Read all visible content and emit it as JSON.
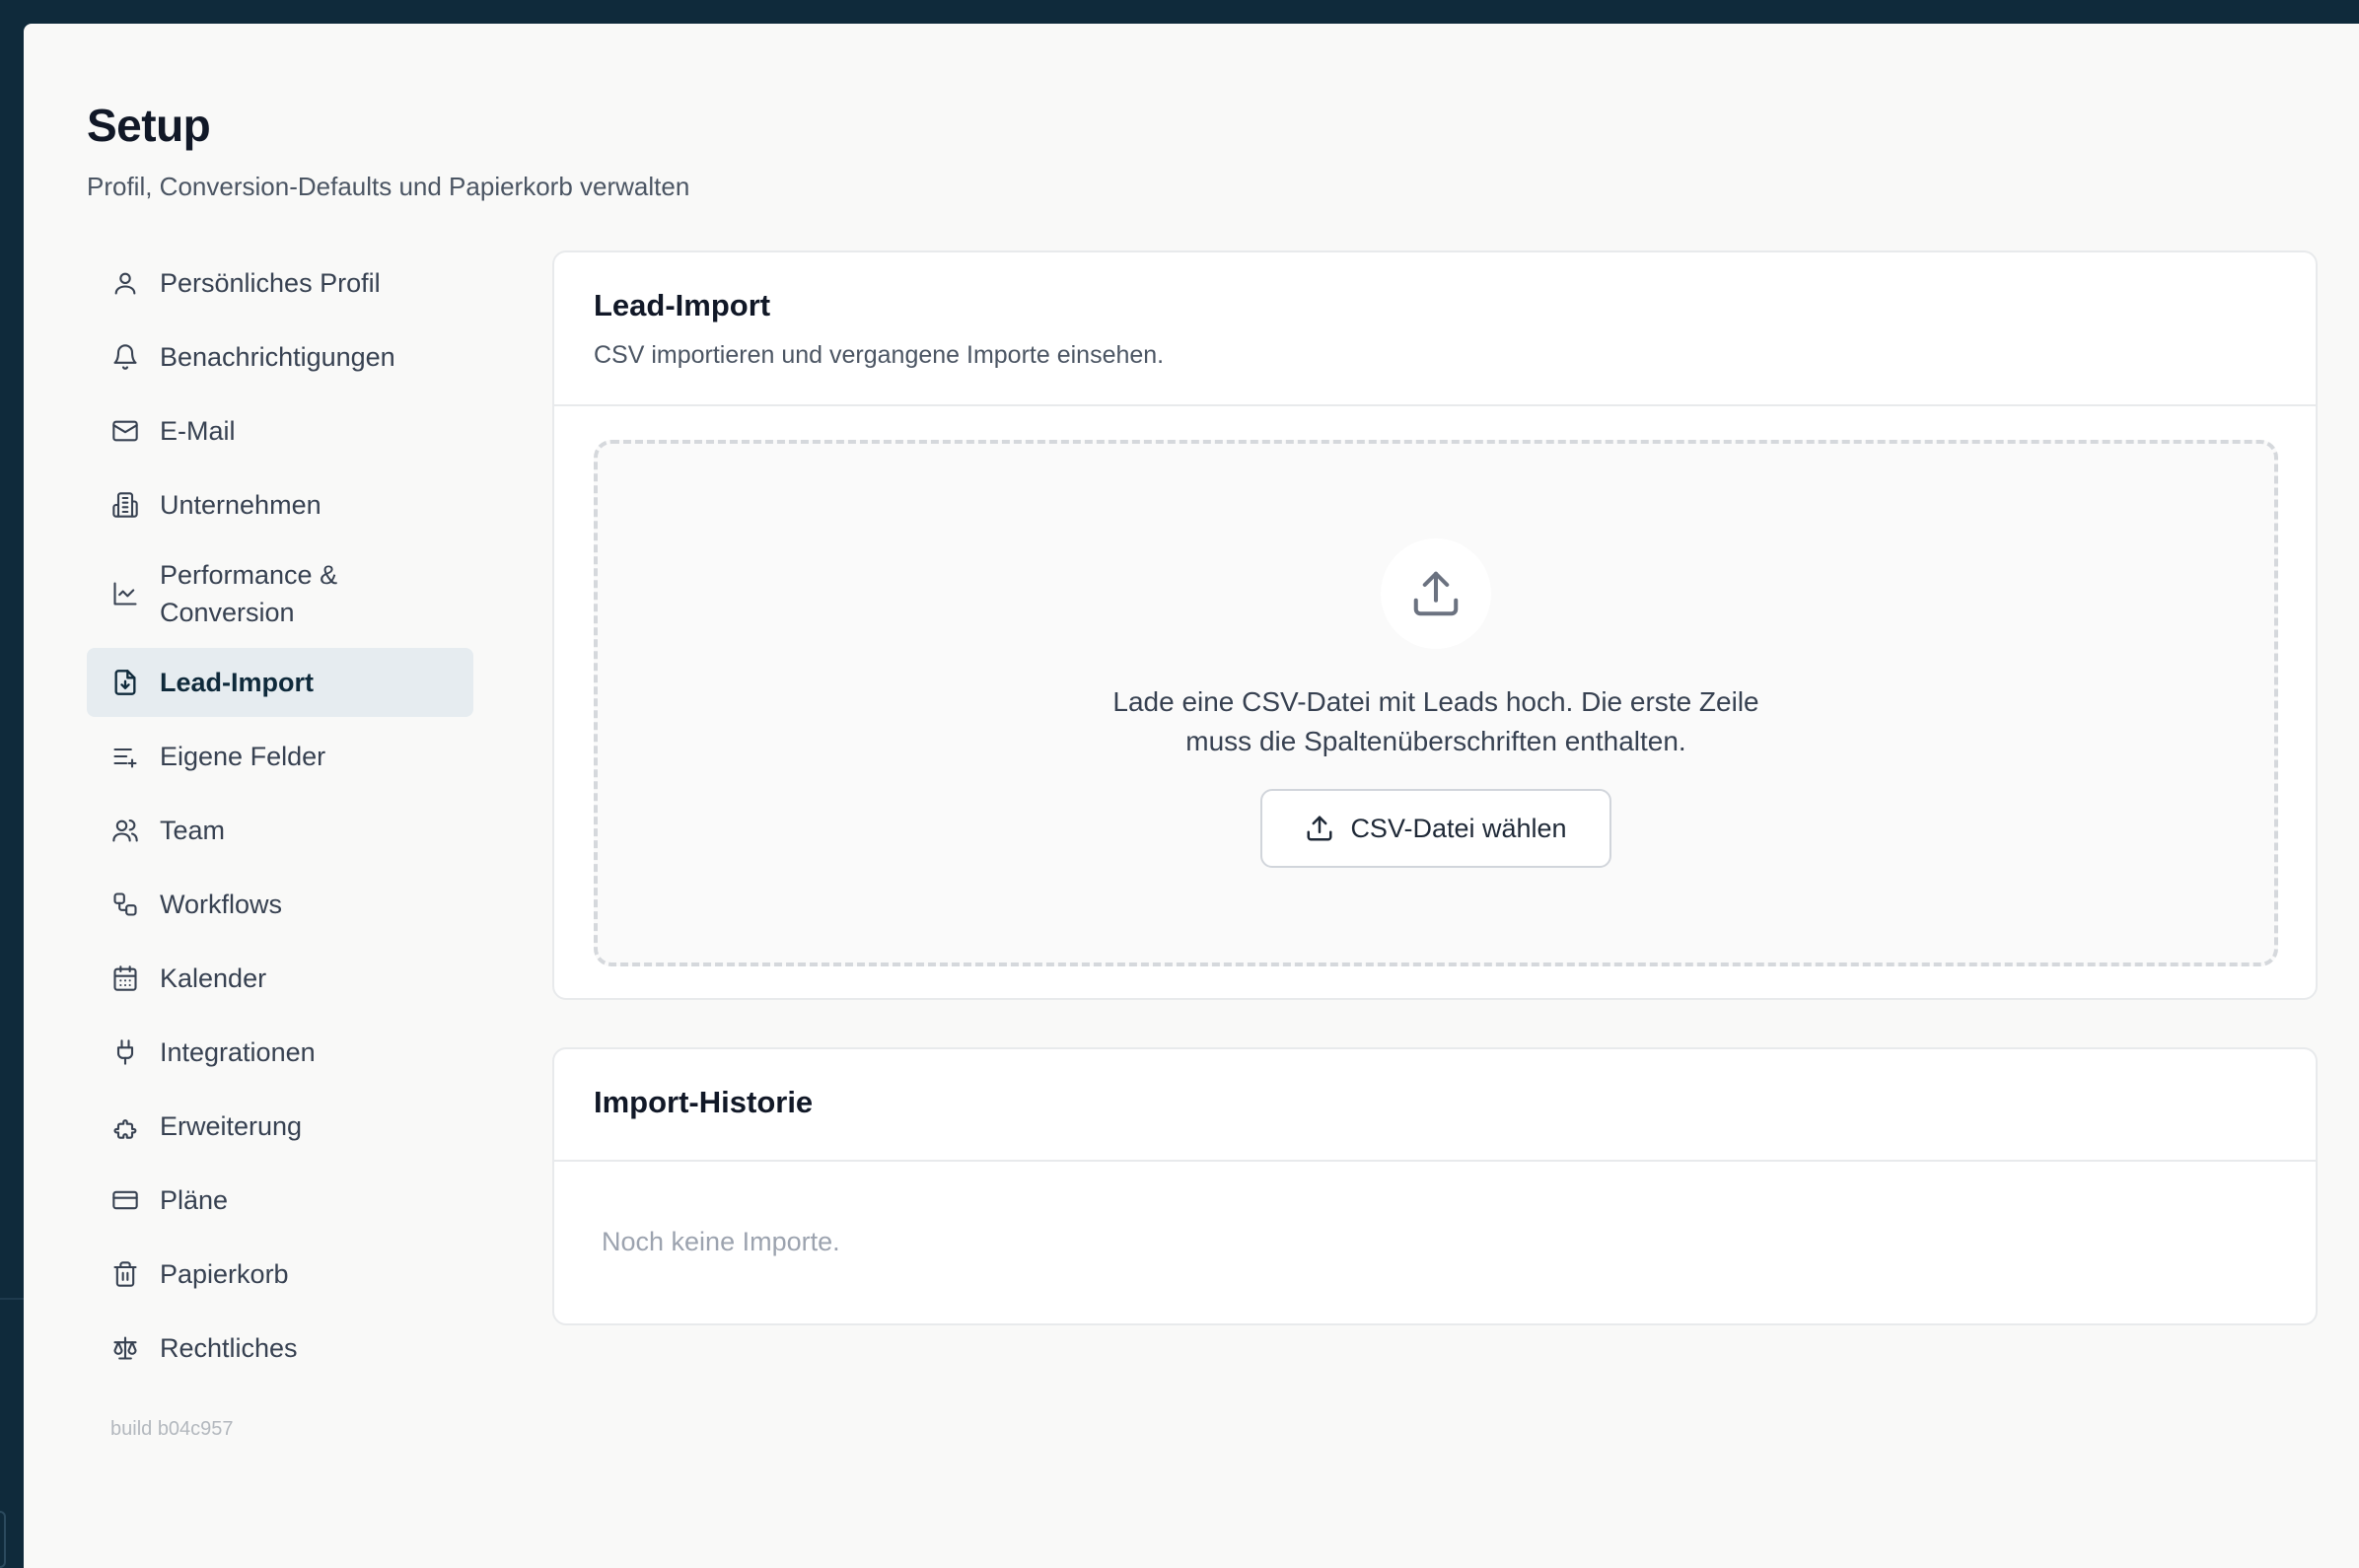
{
  "page": {
    "title": "Setup",
    "subtitle": "Profil, Conversion-Defaults und Papierkorb verwalten"
  },
  "sidebar": {
    "items": [
      {
        "label": "Persönliches Profil",
        "icon": "user-icon"
      },
      {
        "label": "Benachrichtigungen",
        "icon": "bell-icon"
      },
      {
        "label": "E-Mail",
        "icon": "mail-icon"
      },
      {
        "label": "Unternehmen",
        "icon": "building-icon"
      },
      {
        "label": "Performance & Conversion",
        "icon": "line-chart-icon"
      },
      {
        "label": "Lead-Import",
        "icon": "file-import-icon",
        "active": true
      },
      {
        "label": "Eigene Felder",
        "icon": "list-plus-icon"
      },
      {
        "label": "Team",
        "icon": "users-icon"
      },
      {
        "label": "Workflows",
        "icon": "workflow-icon"
      },
      {
        "label": "Kalender",
        "icon": "calendar-icon"
      },
      {
        "label": "Integrationen",
        "icon": "plug-icon"
      },
      {
        "label": "Erweiterung",
        "icon": "puzzle-icon"
      },
      {
        "label": "Pläne",
        "icon": "credit-card-icon"
      },
      {
        "label": "Papierkorb",
        "icon": "trash-icon"
      },
      {
        "label": "Rechtliches",
        "icon": "scale-icon"
      }
    ],
    "build": "build b04c957"
  },
  "import_card": {
    "title": "Lead-Import",
    "description": "CSV importieren und vergangene Importe einsehen.",
    "dropzone_text_line1": "Lade eine CSV-Datei mit Leads hoch. Die erste Zeile",
    "dropzone_text_line2": "muss die Spaltenüberschriften enthalten.",
    "button_label": "CSV-Datei wählen"
  },
  "history_card": {
    "title": "Import-Historie",
    "empty_text": "Noch keine Importe."
  },
  "colors": {
    "frame": "#0f2a3b",
    "background": "#f9f9f8",
    "active_nav": "#e6ecf0",
    "border": "#e8eaec"
  }
}
